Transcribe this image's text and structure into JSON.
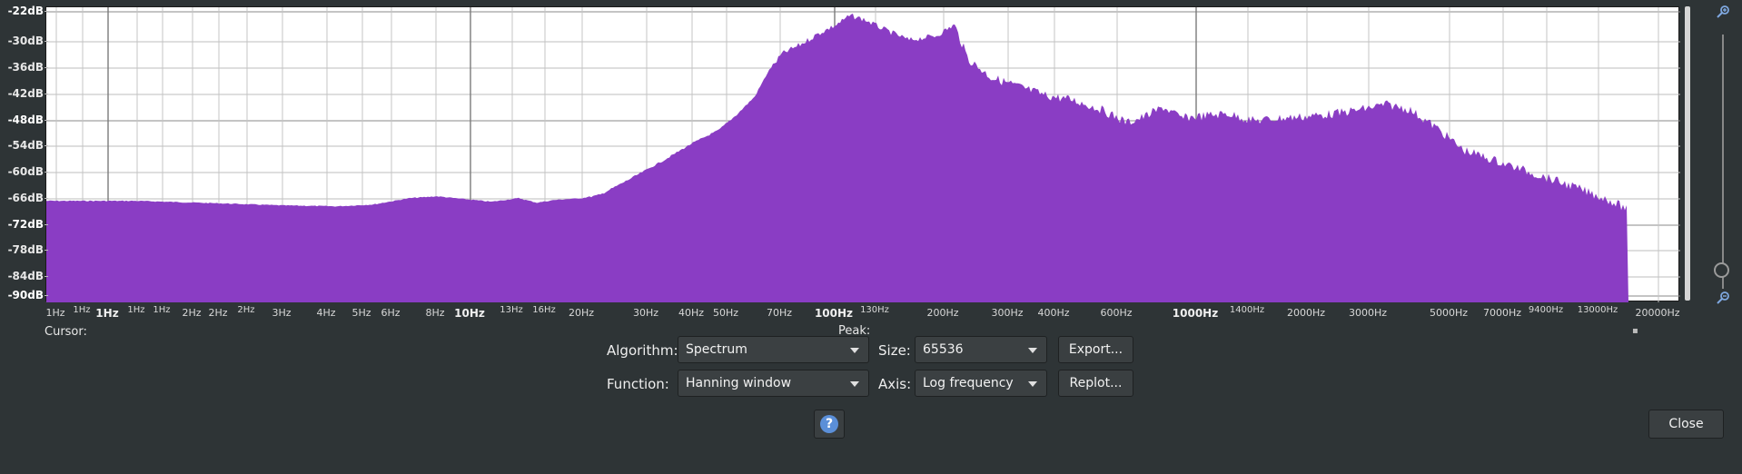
{
  "plot": {
    "y_labels": [
      "-22dB",
      "-30dB",
      "-36dB",
      "-42dB",
      "-48dB",
      "-54dB",
      "-60dB",
      "-66dB",
      "-72dB",
      "-78dB",
      "-84dB",
      "-90dB"
    ],
    "y_bold": [
      "-22dB",
      "-48dB",
      "-72dB",
      "-90dB"
    ],
    "x_labels": [
      "1Hz",
      "1Hz",
      "1Hz",
      "1Hz",
      "1Hz",
      "2Hz",
      "2Hz",
      "2Hz",
      "3Hz",
      "4Hz",
      "5Hz",
      "6Hz",
      "8Hz",
      "10Hz",
      "13Hz",
      "16Hz",
      "20Hz",
      "30Hz",
      "40Hz",
      "50Hz",
      "70Hz",
      "100Hz",
      "130Hz",
      "200Hz",
      "300Hz",
      "400Hz",
      "600Hz",
      "1000Hz",
      "1400Hz",
      "2000Hz",
      "3000Hz",
      "5000Hz",
      "7000Hz",
      "9400Hz",
      "13000Hz",
      "20000Hz"
    ],
    "fill_color": "#8a3dc4"
  },
  "status": {
    "cursor_label": "Cursor:",
    "peak_label": "Peak:"
  },
  "controls": {
    "algorithm_label": "Algorithm:",
    "algorithm_value": "Spectrum",
    "size_label": "Size:",
    "size_value": "65536",
    "export_button": "Export...",
    "function_label": "Function:",
    "function_value": "Hanning window",
    "axis_label": "Axis:",
    "axis_value": "Log frequency",
    "replot_button": "Replot...",
    "help_button": "?",
    "close_button": "Close"
  },
  "colors": {
    "background": "#2e3436",
    "plot_background": "#ffffff",
    "spectrum": "#8a3dc4",
    "help_accent": "#5b8fd8"
  },
  "icons": [
    "zoom-in-icon",
    "zoom-out-icon",
    "help-icon",
    "dropdown-arrow-icon"
  ]
}
